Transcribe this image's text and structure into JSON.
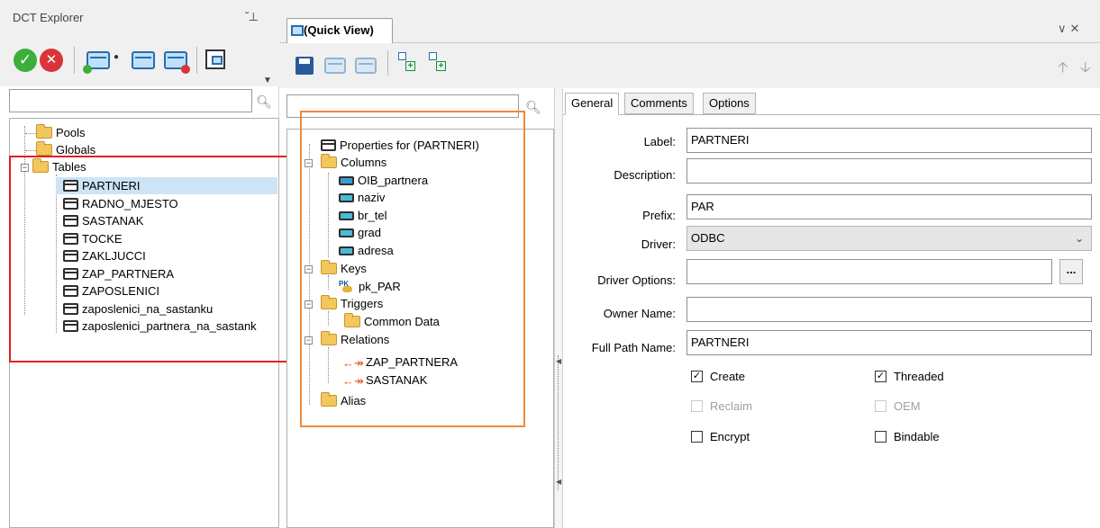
{
  "explorer": {
    "title": "DCT Explorer",
    "tree": {
      "items": [
        {
          "label": "Pools",
          "icon": "folder-icon"
        },
        {
          "label": "Globals",
          "icon": "folder-icon"
        },
        {
          "label": "Tables",
          "icon": "folder-icon",
          "expanded": true
        }
      ],
      "tables": [
        "PARTNERI",
        "RADNO_MJESTO",
        "SASTANAK",
        "TOCKE",
        "ZAKLJUCCI",
        "ZAP_PARTNERA",
        "ZAPOSLENICI",
        "zaposlenici_na_sastanku",
        "zaposlenici_partnera_na_sastank"
      ],
      "selected": "PARTNERI"
    }
  },
  "quickview": {
    "tab_label": "(Quick View)",
    "tree": {
      "properties": "Properties for (PARTNERI)",
      "columns_label": "Columns",
      "columns": [
        "OIB_partnera",
        "naziv",
        "br_tel",
        "grad",
        "adresa"
      ],
      "keys_label": "Keys",
      "keys": [
        "pk_PAR"
      ],
      "triggers_label": "Triggers",
      "triggers": [
        "Common Data"
      ],
      "relations_label": "Relations",
      "relations": [
        "ZAP_PARTNERA",
        "SASTANAK"
      ],
      "alias_label": "Alias"
    }
  },
  "form": {
    "tabs": [
      "General",
      "Comments",
      "Options"
    ],
    "active_tab": "General",
    "fields": {
      "label": {
        "caption": "Label:",
        "value": "PARTNERI"
      },
      "description": {
        "caption": "Description:",
        "value": ""
      },
      "prefix": {
        "caption": "Prefix:",
        "value": "PAR"
      },
      "driver": {
        "caption": "Driver:",
        "value": "ODBC"
      },
      "driver_options": {
        "caption": "Driver Options:",
        "value": "",
        "button": "..."
      },
      "owner_name": {
        "caption": "Owner Name:",
        "value": ""
      },
      "full_path": {
        "caption": "Full Path Name:",
        "value": "PARTNERI"
      }
    },
    "checkboxes": [
      {
        "label": "Create",
        "checked": true,
        "enabled": true
      },
      {
        "label": "Threaded",
        "checked": true,
        "enabled": true
      },
      {
        "label": "Reclaim",
        "checked": false,
        "enabled": false
      },
      {
        "label": "OEM",
        "checked": false,
        "enabled": false
      },
      {
        "label": "Encrypt",
        "checked": false,
        "enabled": true
      },
      {
        "label": "Bindable",
        "checked": false,
        "enabled": true
      }
    ]
  },
  "colors": {
    "red_highlight": "#e11f26",
    "orange_highlight": "#f0883a",
    "selection": "#cce4f7"
  }
}
